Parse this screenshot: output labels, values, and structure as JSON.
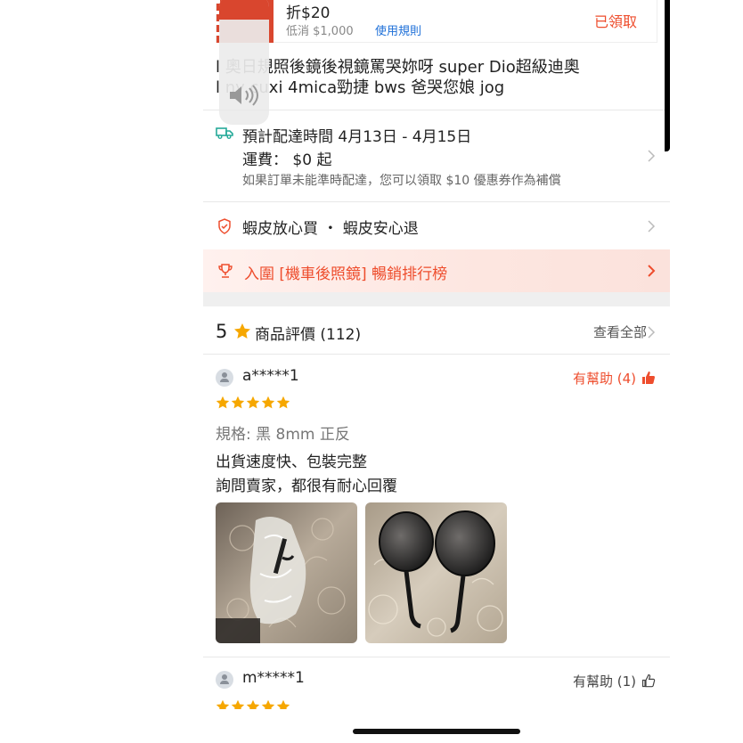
{
  "voucher": {
    "discount": "折$20",
    "min_spend": "低消 $1,000",
    "rules_link": "使用規則",
    "claimed": "已領取"
  },
  "product": {
    "title": "l      奧日規照後鏡後視鏡罵哭妳呀 super Dio超級迪奧\nl        ny cuxi 4mica勁捷 bws 爸哭您娘 jog"
  },
  "shipping": {
    "eta": "預計配達時間 4月13日 - 4月15日",
    "fee": "運費：  $0 起",
    "note": "如果訂單未能準時配達，您可以領取 $10 優惠券作為補償"
  },
  "guarantee": {
    "text": "蝦皮放心買 ・ 蝦皮安心退"
  },
  "ranking": {
    "text": "入圍 [機車後照鏡] 暢銷排行榜"
  },
  "ratings": {
    "score": "5",
    "label": "商品評價 (112)",
    "view_all": "查看全部"
  },
  "reviews": [
    {
      "user": "a*****1",
      "helpful": "有幫助 (4)",
      "stars": 5,
      "spec": "規格: 黑 8mm 正反",
      "comment_line1": "出貨速度快、包裝完整",
      "comment_line2": "詢問賣家，都很有耐心回覆"
    },
    {
      "user": "m*****1",
      "helpful": "有幫助 (1)",
      "stars": 5
    }
  ],
  "colors": {
    "accent": "#ee4d2d",
    "star": "#f6a700",
    "link": "#1d6fd8"
  }
}
